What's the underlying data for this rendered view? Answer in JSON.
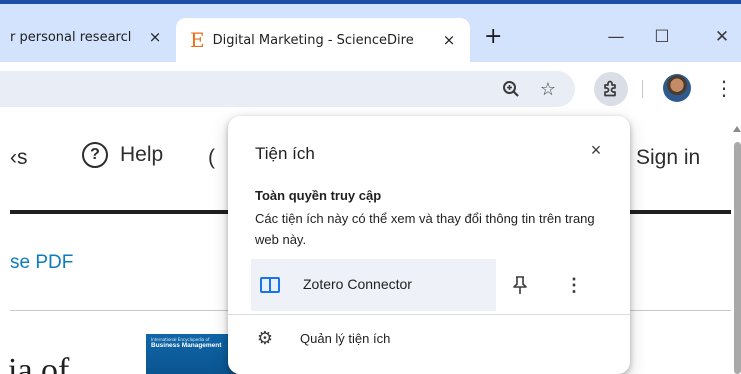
{
  "tabs": [
    {
      "title": "r personal researcl",
      "active": false,
      "close": "×"
    },
    {
      "title": "Digital Marketing - ScienceDire",
      "active": true,
      "close": "×",
      "favicon": "E"
    }
  ],
  "new_tab": "+",
  "window_controls": {
    "minimize": "—",
    "maximize": "☐",
    "close": "✕"
  },
  "toolbar": {
    "zoom_icon": "zoom-icon",
    "bookmark_icon": "star-icon",
    "extensions_icon": "puzzle-icon",
    "menu": "⋮"
  },
  "page": {
    "nav": {
      "books_partial": "‹s",
      "help": "Help",
      "help_glyph": "?",
      "partial": "(",
      "sign_in": "Sign in"
    },
    "pdf_link": "se PDF",
    "heading_partial": "ia of",
    "book_cover": {
      "line1": "International Encyclopedia of",
      "line2": "Business Management"
    }
  },
  "extensions_popup": {
    "title": "Tiện ích",
    "close": "×",
    "section_heading": "Toàn quyền truy cập",
    "section_desc": "Các tiện ích này có thể xem và thay đổi thông tin trên trang web này.",
    "extensions": [
      {
        "name": "Zotero Connector",
        "pinned": false
      }
    ],
    "more": "⋮",
    "manage_label": "Quản lý tiện ích"
  },
  "colors": {
    "tabstrip": "#d3e3fd",
    "accent_topline": "#1e4fa8",
    "link": "#0c7dbb",
    "favicon": "#e9711c"
  }
}
